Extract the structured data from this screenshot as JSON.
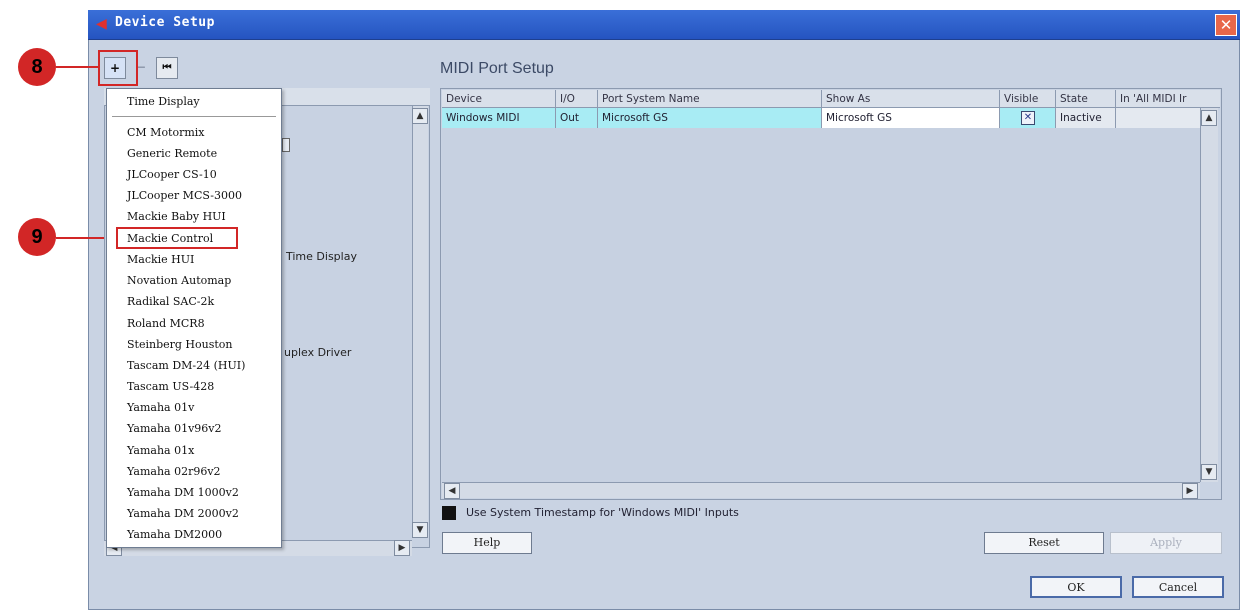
{
  "window": {
    "title": "Device Setup",
    "close_glyph": "✕"
  },
  "toolbar": {
    "add_glyph": "+",
    "remove_glyph": "−",
    "reset_glyph": "⏮"
  },
  "callouts": {
    "first": "8",
    "second": "9"
  },
  "left_panel": {
    "visible_fragments": [
      "Time Display",
      "uplex Driver"
    ]
  },
  "menu": {
    "items": [
      "Time Display",
      "CM Motormix",
      "Generic Remote",
      "JLCooper CS-10",
      "JLCooper MCS-3000",
      "Mackie Baby HUI",
      "Mackie Control",
      "Mackie HUI",
      "Novation Automap",
      "Radikal SAC-2k",
      "Roland MCR8",
      "Steinberg Houston",
      "Tascam DM-24 (HUI)",
      "Tascam US-428",
      "Yamaha 01v",
      "Yamaha 01v96v2",
      "Yamaha 01x",
      "Yamaha 02r96v2",
      "Yamaha DM 1000v2",
      "Yamaha DM 2000v2",
      "Yamaha DM2000"
    ],
    "highlighted": "Mackie Control"
  },
  "midi_port_setup": {
    "title": "MIDI Port Setup",
    "columns": [
      "Device",
      "I/O",
      "Port System Name",
      "Show As",
      "Visible",
      "State",
      "In 'All MIDI Ir"
    ],
    "rows": [
      {
        "device": "Windows MIDI",
        "io": "Out",
        "port_system_name": "Microsoft GS",
        "show_as": "Microsoft GS",
        "visible": "✕",
        "state": "Inactive",
        "in_all_midi": ""
      }
    ],
    "timestamp_label": "Use System Timestamp for 'Windows MIDI' Inputs"
  },
  "buttons": {
    "help": "Help",
    "reset": "Reset",
    "apply": "Apply",
    "ok": "OK",
    "cancel": "Cancel"
  },
  "scroll": {
    "up": "▲",
    "down": "▼",
    "left": "◀",
    "right": "▶"
  },
  "colors": {
    "titlebar": "#2f62cc",
    "callout_red": "#d22626",
    "row_selected": "#a8ecf4",
    "window_bg": "#c9d3e3"
  }
}
